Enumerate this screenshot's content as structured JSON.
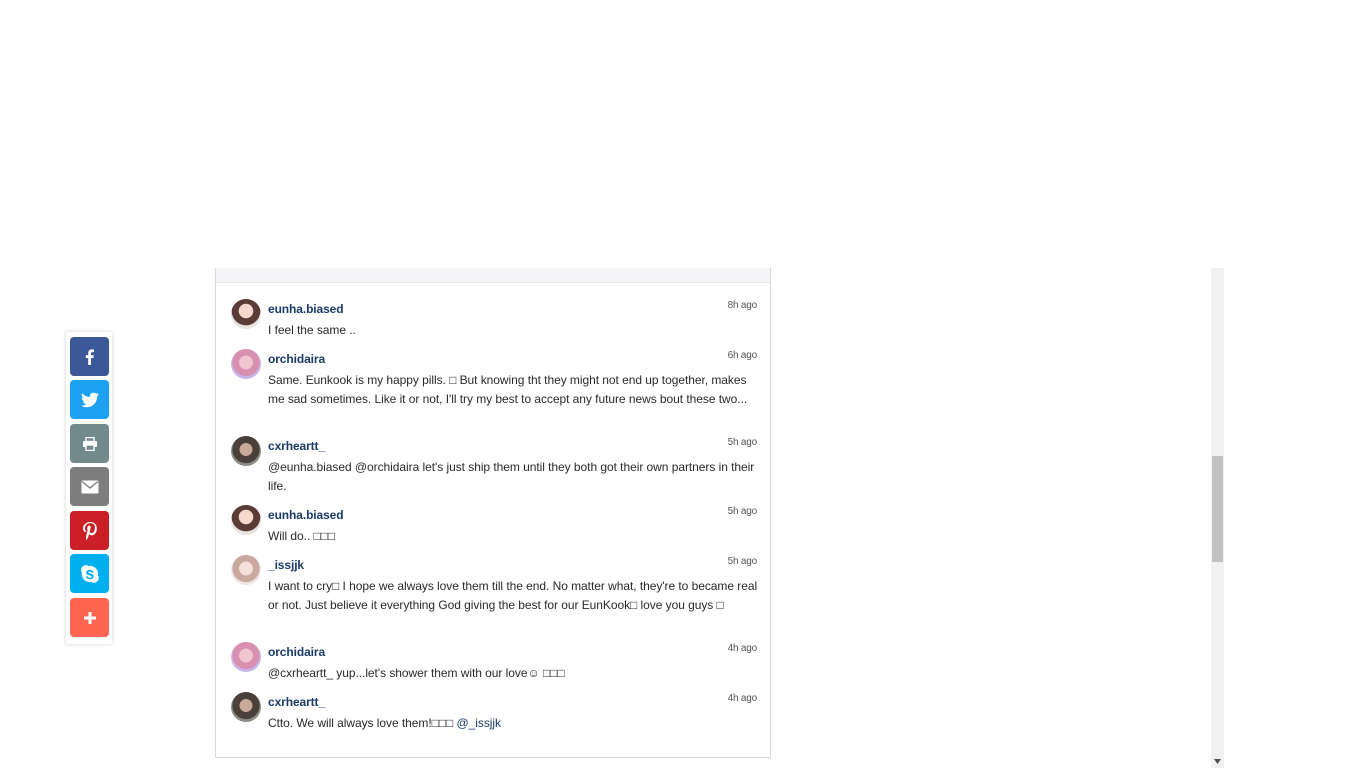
{
  "colors": {
    "facebook": "#3b5998",
    "twitter": "#1da1f2",
    "print": "#738a8d",
    "email": "#7d7d7d",
    "pinterest": "#cb2027",
    "skype": "#00aff0",
    "more": "#ff6550",
    "username": "#1a3a6a"
  },
  "share_bar": [
    {
      "name": "facebook",
      "icon": "facebook-icon"
    },
    {
      "name": "twitter",
      "icon": "twitter-icon"
    },
    {
      "name": "print",
      "icon": "printer-icon"
    },
    {
      "name": "email",
      "icon": "envelope-icon"
    },
    {
      "name": "pinterest",
      "icon": "pinterest-icon"
    },
    {
      "name": "skype",
      "icon": "skype-icon"
    },
    {
      "name": "more",
      "icon": "plus-icon"
    }
  ],
  "comments": [
    {
      "user": "eunha.biased",
      "time": "8h ago",
      "text": "I feel the same .."
    },
    {
      "user": "orchidaira",
      "time": "6h ago",
      "text": "Same. Eunkook is my happy pills. □ But knowing tht they might not end up together, makes me sad sometimes. Like it or not, I'll try my best to accept any future news bout these two..."
    },
    {
      "user": "cxrheartt_",
      "time": "5h ago",
      "text": "@eunha.biased @orchidaira let's just ship them until they both got their own partners in their life."
    },
    {
      "user": "eunha.biased",
      "time": "5h ago",
      "text": "Will do.. □□□"
    },
    {
      "user": "_issjjk",
      "time": "5h ago",
      "text": "I want to cry□ I hope we always love them till the end. No matter what, they're to became real or not. Just believe it everything God giving the best for our EunKook□ love you guys □"
    },
    {
      "user": "orchidaira",
      "time": "4h ago",
      "text": "@cxrheartt_ yup...let's shower them with our love☺ □□□"
    },
    {
      "user": "cxrheartt_",
      "time": "4h ago",
      "text": "Ctto. We will always love them!□□□ ",
      "mention": "@_issjjk"
    }
  ]
}
